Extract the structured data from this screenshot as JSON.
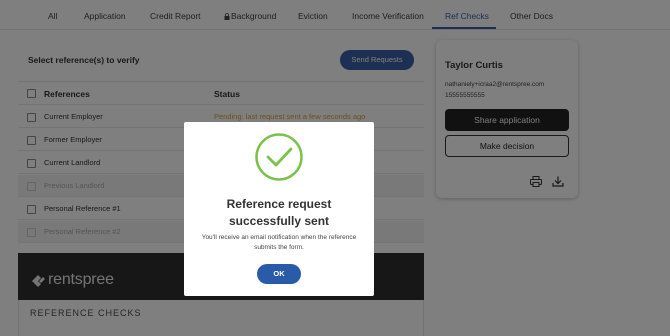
{
  "tabs": [
    {
      "label": "All"
    },
    {
      "label": "Application"
    },
    {
      "label": "Credit Report"
    },
    {
      "label": "Background"
    },
    {
      "label": "Eviction"
    },
    {
      "label": "Income Verification"
    },
    {
      "label": "Ref Checks"
    },
    {
      "label": "Other Docs"
    }
  ],
  "active_tab": "Ref Checks",
  "references_panel": {
    "title": "Select reference(s) to verify",
    "send_button": "Send Requests",
    "col_references": "References",
    "col_status": "Status",
    "rows": [
      {
        "label": "Current Employer",
        "status": "Pending: last request sent a few seconds ago",
        "disabled": false
      },
      {
        "label": "Former Employer",
        "status": "",
        "disabled": false
      },
      {
        "label": "Current Landlord",
        "status": "",
        "disabled": false
      },
      {
        "label": "Previous Landlord",
        "status": "",
        "disabled": true
      },
      {
        "label": "Personal Reference #1",
        "status": "",
        "disabled": false
      },
      {
        "label": "Personal Reference #2",
        "status": "",
        "disabled": true
      }
    ]
  },
  "brand": {
    "name": "rentspree"
  },
  "reference_checks_heading": "REFERENCE CHECKS",
  "applicant_card": {
    "name": "Taylor Curtis",
    "email": "nathaniely+icraa2@rentspree.com",
    "phone": "15555555555",
    "share_button": "Share application",
    "decision_button": "Make decision"
  },
  "modal": {
    "title_line1": "Reference request",
    "title_line2": "successfully sent",
    "message": "You'll receive an email notification when the reference submits the form.",
    "ok_button": "OK"
  },
  "colors": {
    "accent": "#3c5ea8",
    "success": "#7cc24a",
    "pending": "#d4a13a"
  }
}
